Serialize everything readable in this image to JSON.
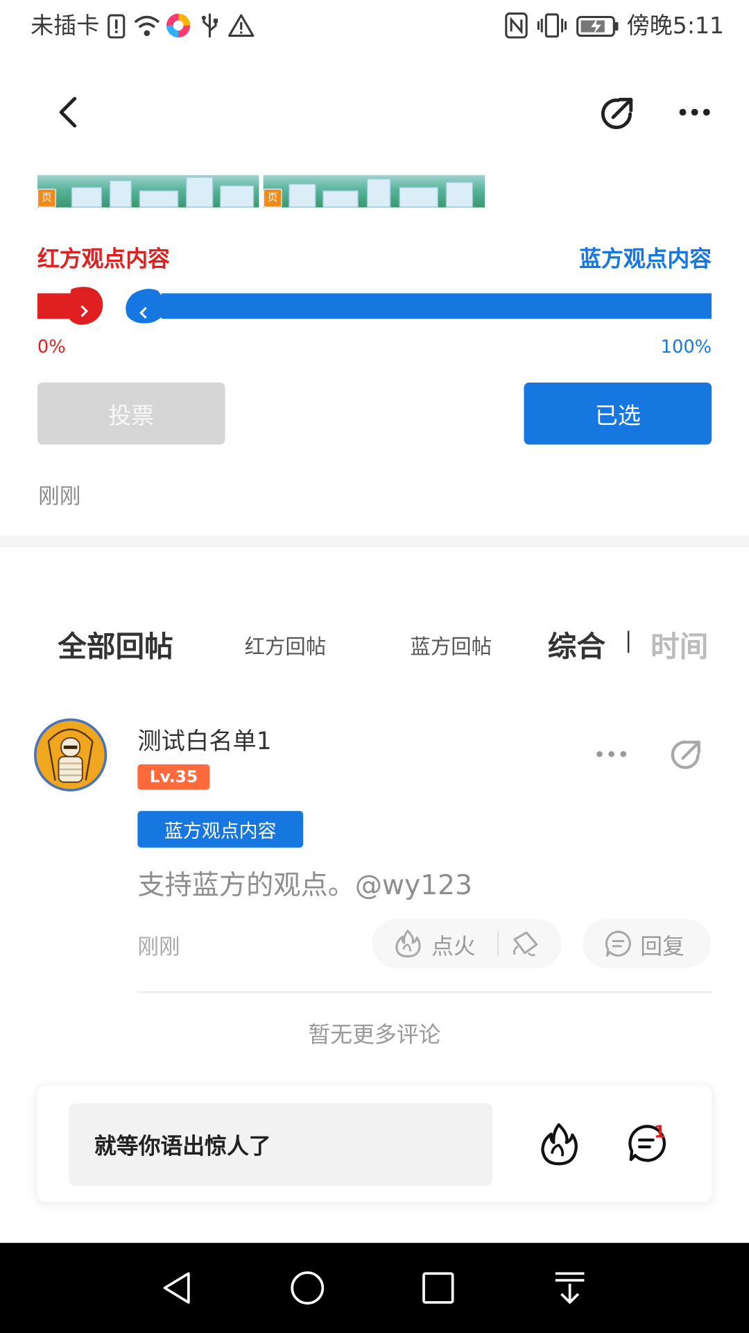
{
  "status_bar": {
    "carrier": "未插卡",
    "time": "傍晚5:11"
  },
  "topic": {
    "red_label": "红方观点内容",
    "blue_label": "蓝方观点内容",
    "red_percent": "0%",
    "blue_percent": "100%",
    "red_fraction": 0.0,
    "blue_fraction": 1.0,
    "vote_button": "投票",
    "selected_button": "已选",
    "timestamp": "刚刚"
  },
  "tabs": {
    "all": "全部回帖",
    "red": "红方回帖",
    "blue": "蓝方回帖",
    "sort_composite": "综合",
    "sort_time": "时间"
  },
  "post": {
    "username": "测试白名单1",
    "level": "Lv.35",
    "side_tag": "蓝方观点内容",
    "content": "支持蓝方的观点。@wy123",
    "timestamp": "刚刚",
    "fire_label": "点火",
    "reply_label": "回复"
  },
  "footer_note": "暂无更多评论",
  "composer": {
    "placeholder": "就等你语出惊人了",
    "comment_badge": "1"
  },
  "colors": {
    "red": "#e02020",
    "blue": "#1677e0"
  }
}
